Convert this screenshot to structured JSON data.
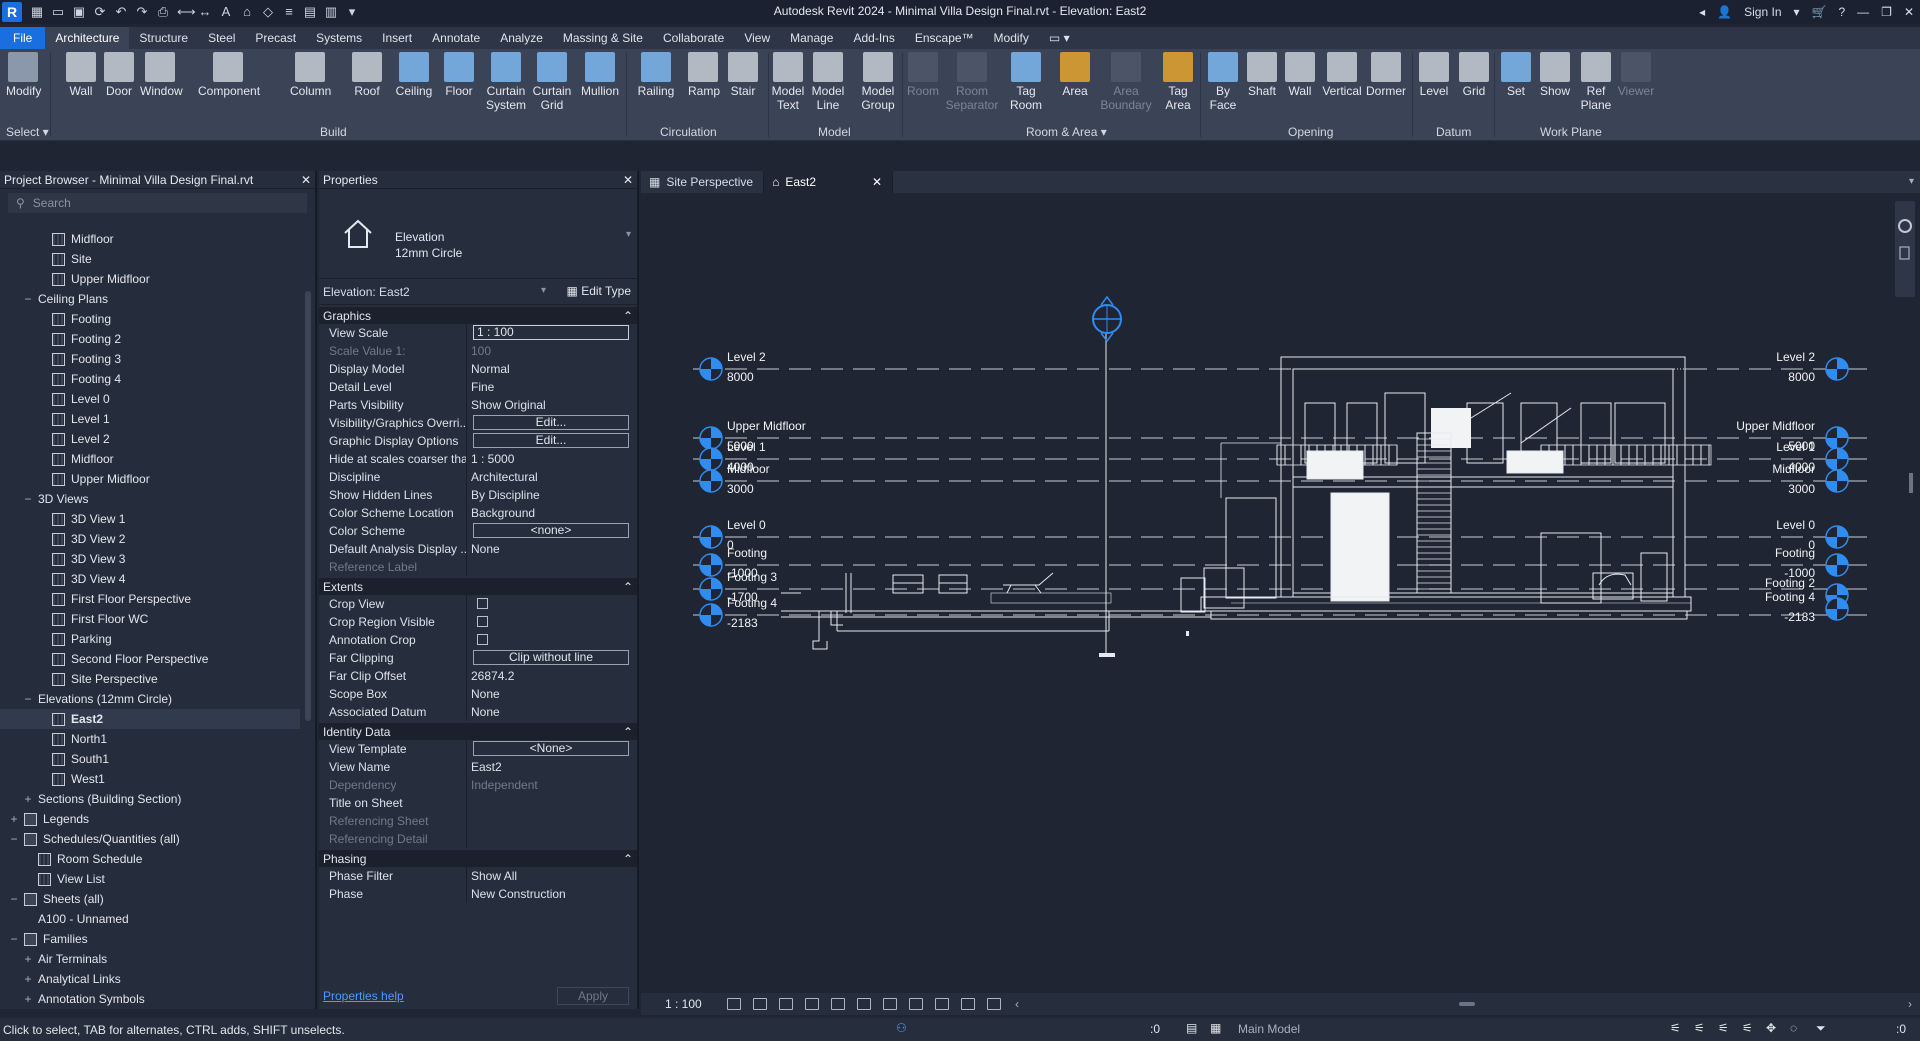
{
  "app": {
    "title": "Autodesk Revit 2024 - Minimal Villa Design Final.rvt - Elevation: East2",
    "sign_in": "Sign In",
    "logo": "R"
  },
  "ribbon_tabs": [
    "File",
    "Architecture",
    "Structure",
    "Steel",
    "Precast",
    "Systems",
    "Insert",
    "Annotate",
    "Analyze",
    "Massing & Site",
    "Collaborate",
    "View",
    "Manage",
    "Add-Ins",
    "Enscape™",
    "Modify"
  ],
  "ribbon": {
    "select_label": "Select",
    "panels": [
      "Build",
      "Circulation",
      "Model",
      "Room & Area",
      "Opening",
      "Datum",
      "Work Plane"
    ],
    "buttons": {
      "modify": "Modify",
      "wall": "Wall",
      "door": "Door",
      "window": "Window",
      "component": "Component",
      "column": "Column",
      "roof": "Roof",
      "ceiling": "Ceiling",
      "floor": "Floor",
      "curtain_system": "Curtain\nSystem",
      "curtain_grid": "Curtain\nGrid",
      "mullion": "Mullion",
      "railing": "Railing",
      "ramp": "Ramp",
      "stair": "Stair",
      "model_text": "Model\nText",
      "model_line": "Model\nLine",
      "model_group": "Model\nGroup",
      "room": "Room",
      "room_separator": "Room\nSeparator",
      "tag_room": "Tag\nRoom",
      "area": "Area",
      "area_boundary": "Area\nBoundary",
      "tag_area": "Tag\nArea",
      "by_face": "By\nFace",
      "shaft": "Shaft",
      "wall_open": "Wall",
      "vertical": "Vertical",
      "dormer": "Dormer",
      "level": "Level",
      "grid": "Grid",
      "set": "Set",
      "show": "Show",
      "ref_plane": "Ref\nPlane",
      "viewer": "Viewer"
    }
  },
  "project_browser": {
    "title": "Project Browser - Minimal Villa Design Final.rvt",
    "search_placeholder": "Search",
    "rows": [
      {
        "label": "Midfloor",
        "indent": 2,
        "type": "view"
      },
      {
        "label": "Site",
        "indent": 2,
        "type": "view"
      },
      {
        "label": "Upper Midfloor",
        "indent": 2,
        "type": "view"
      },
      {
        "label": "Ceiling Plans",
        "indent": 1,
        "type": "group",
        "toggle": "−"
      },
      {
        "label": "Footing",
        "indent": 2,
        "type": "view"
      },
      {
        "label": "Footing 2",
        "indent": 2,
        "type": "view"
      },
      {
        "label": "Footing 3",
        "indent": 2,
        "type": "view"
      },
      {
        "label": "Footing 4",
        "indent": 2,
        "type": "view"
      },
      {
        "label": "Level 0",
        "indent": 2,
        "type": "view"
      },
      {
        "label": "Level 1",
        "indent": 2,
        "type": "view"
      },
      {
        "label": "Level 2",
        "indent": 2,
        "type": "view"
      },
      {
        "label": "Midfloor",
        "indent": 2,
        "type": "view"
      },
      {
        "label": "Upper Midfloor",
        "indent": 2,
        "type": "view"
      },
      {
        "label": "3D Views",
        "indent": 1,
        "type": "group",
        "toggle": "−"
      },
      {
        "label": "3D View 1",
        "indent": 2,
        "type": "view"
      },
      {
        "label": "3D View 2",
        "indent": 2,
        "type": "view"
      },
      {
        "label": "3D View 3",
        "indent": 2,
        "type": "view"
      },
      {
        "label": "3D View 4",
        "indent": 2,
        "type": "view"
      },
      {
        "label": "First Floor Perspective",
        "indent": 2,
        "type": "view"
      },
      {
        "label": "First Floor WC",
        "indent": 2,
        "type": "view"
      },
      {
        "label": "Parking",
        "indent": 2,
        "type": "view"
      },
      {
        "label": "Second Floor Perspective",
        "indent": 2,
        "type": "view"
      },
      {
        "label": "Site Perspective",
        "indent": 2,
        "type": "view"
      },
      {
        "label": "Elevations (12mm Circle)",
        "indent": 1,
        "type": "group",
        "toggle": "−"
      },
      {
        "label": "East2",
        "indent": 2,
        "type": "view",
        "selected": true
      },
      {
        "label": "North1",
        "indent": 2,
        "type": "view"
      },
      {
        "label": "South1",
        "indent": 2,
        "type": "view"
      },
      {
        "label": "West1",
        "indent": 2,
        "type": "view"
      },
      {
        "label": "Sections (Building Section)",
        "indent": 1,
        "type": "group",
        "toggle": "+"
      },
      {
        "label": "Legends",
        "indent": 0,
        "type": "folder",
        "toggle": "+"
      },
      {
        "label": "Schedules/Quantities (all)",
        "indent": 0,
        "type": "folder",
        "toggle": "−"
      },
      {
        "label": "Room Schedule",
        "indent": 1,
        "type": "view"
      },
      {
        "label": "View List",
        "indent": 1,
        "type": "view"
      },
      {
        "label": "Sheets (all)",
        "indent": 0,
        "type": "folder",
        "toggle": "−"
      },
      {
        "label": "A100 - Unnamed",
        "indent": 1,
        "type": "plain"
      },
      {
        "label": "Families",
        "indent": 0,
        "type": "folder",
        "toggle": "−"
      },
      {
        "label": "Air Terminals",
        "indent": 1,
        "type": "group",
        "toggle": "+"
      },
      {
        "label": "Analytical Links",
        "indent": 1,
        "type": "group",
        "toggle": "+"
      },
      {
        "label": "Annotation Symbols",
        "indent": 1,
        "type": "group",
        "toggle": "+"
      }
    ]
  },
  "properties": {
    "title": "Properties",
    "type_line1": "Elevation",
    "type_line2": "12mm Circle",
    "instance": "Elevation: East2",
    "edit_type": "Edit Type",
    "sections": [
      {
        "name": "Graphics",
        "rows": [
          {
            "k": "View Scale",
            "v": "1 : 100",
            "style": "box"
          },
          {
            "k": "Scale Value    1:",
            "v": "100",
            "dis": true
          },
          {
            "k": "Display Model",
            "v": "Normal"
          },
          {
            "k": "Detail Level",
            "v": "Fine"
          },
          {
            "k": "Parts Visibility",
            "v": "Show Original"
          },
          {
            "k": "Visibility/Graphics Overri...",
            "v": "Edit...",
            "style": "btn"
          },
          {
            "k": "Graphic Display Options",
            "v": "Edit...",
            "style": "btn"
          },
          {
            "k": "Hide at scales coarser than",
            "v": "1 : 5000"
          },
          {
            "k": "Discipline",
            "v": "Architectural"
          },
          {
            "k": "Show Hidden Lines",
            "v": "By Discipline"
          },
          {
            "k": "Color Scheme Location",
            "v": "Background"
          },
          {
            "k": "Color Scheme",
            "v": "<none>",
            "style": "btn"
          },
          {
            "k": "Default Analysis Display ...",
            "v": "None"
          },
          {
            "k": "Reference Label",
            "v": "",
            "dis": true
          }
        ]
      },
      {
        "name": "Extents",
        "rows": [
          {
            "k": "Crop View",
            "v": "",
            "style": "cb"
          },
          {
            "k": "Crop Region Visible",
            "v": "",
            "style": "cb"
          },
          {
            "k": "Annotation Crop",
            "v": "",
            "style": "cb"
          },
          {
            "k": "Far Clipping",
            "v": "Clip without line",
            "style": "btn"
          },
          {
            "k": "Far Clip Offset",
            "v": "26874.2"
          },
          {
            "k": "Scope Box",
            "v": "None"
          },
          {
            "k": "Associated Datum",
            "v": "None"
          }
        ]
      },
      {
        "name": "Identity Data",
        "rows": [
          {
            "k": "View Template",
            "v": "<None>",
            "style": "btn"
          },
          {
            "k": "View Name",
            "v": "East2"
          },
          {
            "k": "Dependency",
            "v": "Independent",
            "dis": true
          },
          {
            "k": "Title on Sheet",
            "v": ""
          },
          {
            "k": "Referencing Sheet",
            "v": "",
            "dis": true
          },
          {
            "k": "Referencing Detail",
            "v": "",
            "dis": true
          }
        ]
      },
      {
        "name": "Phasing",
        "rows": [
          {
            "k": "Phase Filter",
            "v": "Show All"
          },
          {
            "k": "Phase",
            "v": "New Construction"
          }
        ]
      }
    ],
    "help": "Properties help",
    "apply": "Apply"
  },
  "view_tabs": [
    {
      "label": "Site Perspective",
      "active": false
    },
    {
      "label": "East2",
      "active": true
    }
  ],
  "elevation": {
    "left_levels": [
      {
        "name": "Level 2",
        "value": "8000"
      },
      {
        "name": "Upper Midfloor",
        "value": "5000"
      },
      {
        "name": "Level 1",
        "value": "4000"
      },
      {
        "name": "Midfloor",
        "value": "3000"
      },
      {
        "name": "Level 0",
        "value": "0"
      },
      {
        "name": "Footing",
        "value": "-1000"
      },
      {
        "name": "Footing 3",
        "value": "-1700"
      },
      {
        "name": "Footing 4",
        "value": "-2183"
      }
    ],
    "right_levels": [
      {
        "name": "Level 2",
        "value": "8000"
      },
      {
        "name": "Upper Midfloor",
        "value": "5000"
      },
      {
        "name": "Level 1",
        "value": "4000"
      },
      {
        "name": "Midfloor",
        "value": "3000"
      },
      {
        "name": "Level 0",
        "value": "0"
      },
      {
        "name": "Footing",
        "value": "-1000"
      },
      {
        "name": "Footing 2",
        "value": ""
      },
      {
        "name": "Footing 4",
        "value": "-2183"
      }
    ]
  },
  "view_control": {
    "scale": "1 : 100"
  },
  "status": {
    "text": "Click to select, TAB for alternates, CTRL adds, SHIFT unselects.",
    "zero": ":0",
    "model": "Main Model",
    "filter": ":0"
  },
  "colors": {
    "accent": "#1a6fe0",
    "level_head": "#2f8cf0",
    "canvas": "#1f2532",
    "ribbon": "#3b4456"
  }
}
